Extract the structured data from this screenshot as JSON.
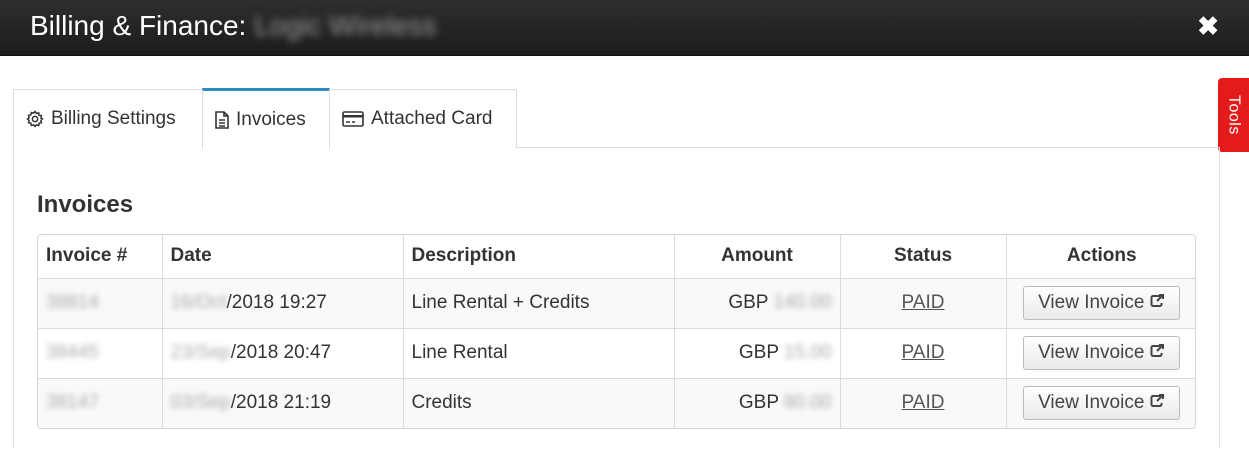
{
  "header": {
    "title": "Billing & Finance:",
    "account_name": "Logic Wireless",
    "close_glyph": "✖"
  },
  "tools_tab": {
    "label": "Tools",
    "color": "#e31b1b"
  },
  "tabs": [
    {
      "label": "Billing Settings",
      "icon": "gear-icon",
      "active": false
    },
    {
      "label": "Invoices",
      "icon": "document-icon",
      "active": true
    },
    {
      "label": "Attached Card",
      "icon": "credit-card-icon",
      "active": false
    }
  ],
  "accent_color": "#2d8bc0",
  "section": {
    "title": "Invoices"
  },
  "table": {
    "columns": [
      "Invoice #",
      "Date",
      "Description",
      "Amount",
      "Status",
      "Actions"
    ],
    "rows": [
      {
        "invoice_no": "38814",
        "date_prefix": "16/Oct",
        "date_suffix": "/2018 19:27",
        "description": "Line Rental + Credits",
        "currency": "GBP",
        "amount": "140.00",
        "status": "PAID",
        "action": "View Invoice"
      },
      {
        "invoice_no": "38445",
        "date_prefix": "23/Sep",
        "date_suffix": "/2018 20:47",
        "description": "Line Rental",
        "currency": "GBP",
        "amount": "15.00",
        "status": "PAID",
        "action": "View Invoice"
      },
      {
        "invoice_no": "38147",
        "date_prefix": "03/Sep",
        "date_suffix": "/2018 21:19",
        "description": "Credits",
        "currency": "GBP",
        "amount": "80.00",
        "status": "PAID",
        "action": "View Invoice"
      }
    ]
  }
}
